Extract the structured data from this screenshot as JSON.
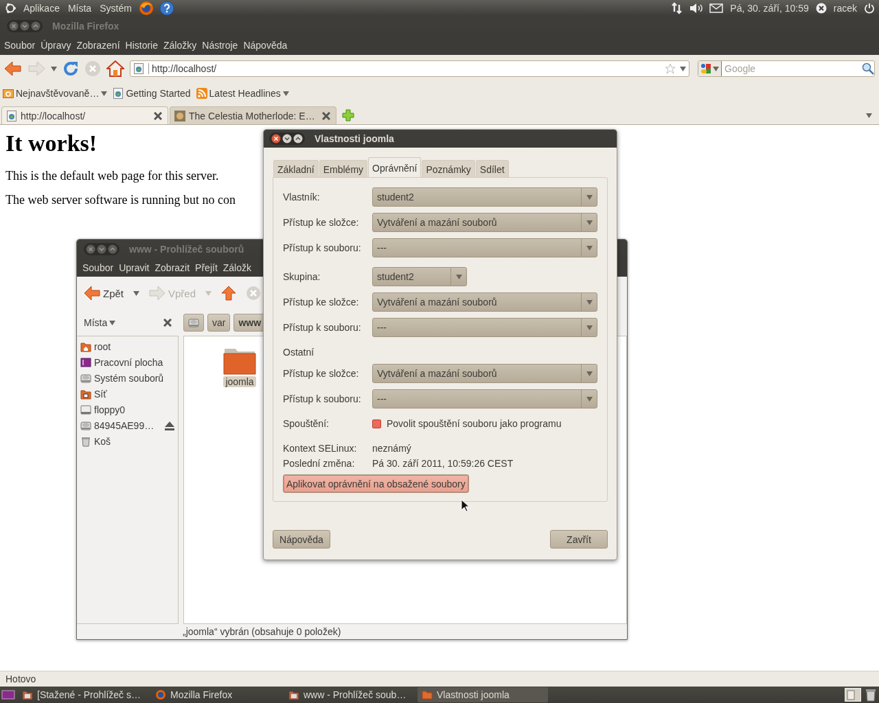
{
  "top_panel": {
    "menus": [
      "Aplikace",
      "Místa",
      "Systém"
    ],
    "clock": "Pá, 30. září, 10:59",
    "user": "racek"
  },
  "browser": {
    "title": "Mozilla Firefox",
    "menu": [
      "Soubor",
      "Úpravy",
      "Zobrazení",
      "Historie",
      "Záložky",
      "Nástroje",
      "Nápověda"
    ],
    "address": "http://localhost/",
    "search_placeholder": "Google",
    "bookmarks": [
      {
        "label": "Nejnavštěvovaně…",
        "kind": "folder",
        "dropdown": true
      },
      {
        "label": "Getting Started",
        "kind": "page",
        "dropdown": false
      },
      {
        "label": "Latest Headlines",
        "kind": "feed",
        "dropdown": true
      }
    ],
    "tabs": [
      {
        "label": "http://localhost/",
        "selected": true,
        "kind": "page"
      },
      {
        "label": "The Celestia Motherlode: E…",
        "selected": false,
        "kind": "image"
      }
    ],
    "page": {
      "heading": "It works!",
      "paragraphs": [
        "This is the default web page for this server.",
        "The web server software is running but no con"
      ]
    },
    "status": "Hotovo"
  },
  "file_manager": {
    "title": "www - Prohlížeč souborů",
    "menu": [
      "Soubor",
      "Upravit",
      "Zobrazit",
      "Přejít",
      "Záložk"
    ],
    "toolbar": [
      {
        "label": "Zpět",
        "kind": "back",
        "disabled": false
      },
      {
        "label": "Vpřed",
        "kind": "forward",
        "disabled": true
      }
    ],
    "sidebar": {
      "title": "Místa",
      "items": [
        {
          "label": "root",
          "kind": "home",
          "eject": false
        },
        {
          "label": "Pracovní plocha",
          "kind": "desktop",
          "eject": false
        },
        {
          "label": "Systém souborů",
          "kind": "drive",
          "eject": false
        },
        {
          "label": "Síť",
          "kind": "network",
          "eject": false
        },
        {
          "label": "floppy0",
          "kind": "floppy",
          "eject": false
        },
        {
          "label": "84945AE99…",
          "kind": "drive",
          "eject": true
        },
        {
          "label": "Koš",
          "kind": "trash",
          "eject": false
        }
      ]
    },
    "path": [
      {
        "label": "var",
        "selected": false
      },
      {
        "label": "www",
        "selected": true
      }
    ],
    "files": [
      {
        "label": "joomla",
        "selected": true
      }
    ],
    "status": "„joomla“ vybrán (obsahuje 0 položek)"
  },
  "dialog": {
    "title": "Vlastnosti joomla",
    "tabs": [
      {
        "label": "Základní",
        "selected": false
      },
      {
        "label": "Emblémy",
        "selected": false
      },
      {
        "label": "Oprávnění",
        "selected": true
      },
      {
        "label": "Poznámky",
        "selected": false
      },
      {
        "label": "Sdílet",
        "selected": false
      }
    ],
    "groups": [
      {
        "rows": [
          {
            "label": "Vlastník:",
            "value": "student2",
            "kind": "combo"
          },
          {
            "label": "Přístup ke složce:",
            "value": "Vytváření a mazání souborů",
            "kind": "combo"
          },
          {
            "label": "Přístup k souboru:",
            "value": "---",
            "kind": "combo"
          }
        ]
      },
      {
        "rows": [
          {
            "label": "Skupina:",
            "value": "student2",
            "kind": "combo_short"
          },
          {
            "label": "Přístup ke složce:",
            "value": "Vytváření a mazání souborů",
            "kind": "combo"
          },
          {
            "label": "Přístup k souboru:",
            "value": "---",
            "kind": "combo"
          }
        ]
      },
      {
        "heading": "Ostatní",
        "rows": [
          {
            "label": "Přístup ke složce:",
            "value": "Vytváření a mazání souborů",
            "kind": "combo"
          },
          {
            "label": "Přístup k souboru:",
            "value": "---",
            "kind": "combo"
          }
        ]
      }
    ],
    "execute": {
      "label": "Spouštění:",
      "option": "Povolit spouštění souboru jako programu",
      "checked": false
    },
    "info": [
      {
        "label": "Kontext SELinux:",
        "value": "neznámý"
      },
      {
        "label": "Poslední změna:",
        "value": "Pá 30. září 2011, 10:59:26 CEST"
      }
    ],
    "apply_button": {
      "label": "Aplikovat oprávnění na obsažené soubory",
      "hovered": true
    },
    "buttons": [
      {
        "label": "Nápověda",
        "kind": "help"
      },
      {
        "label": "Zavřít",
        "kind": "close"
      }
    ]
  },
  "taskbar": [
    {
      "label": "[Stažené - Prohlížeč s…",
      "kind": "files",
      "selected": false
    },
    {
      "label": "Mozilla Firefox",
      "kind": "browser",
      "selected": false
    },
    {
      "label": "www - Prohlížeč soub…",
      "kind": "files",
      "selected": false
    },
    {
      "label": "Vlastnosti joomla",
      "kind": "folder",
      "selected": true
    }
  ]
}
